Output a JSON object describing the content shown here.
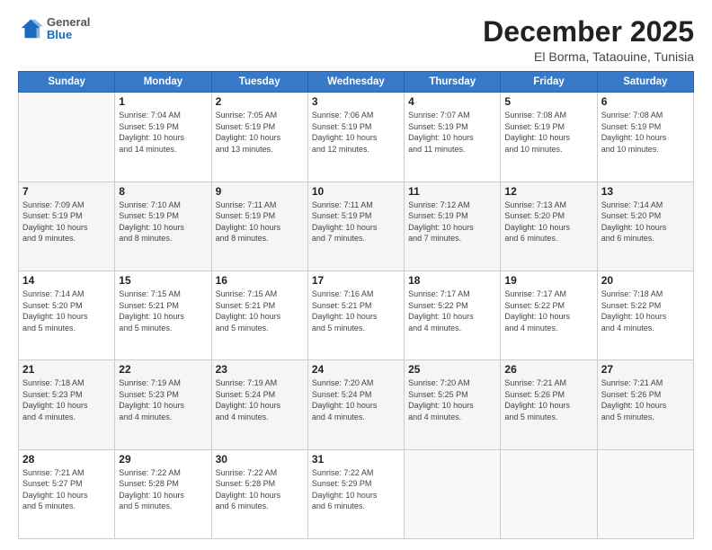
{
  "header": {
    "logo_general": "General",
    "logo_blue": "Blue",
    "month_title": "December 2025",
    "location": "El Borma, Tataouine, Tunisia"
  },
  "days_of_week": [
    "Sunday",
    "Monday",
    "Tuesday",
    "Wednesday",
    "Thursday",
    "Friday",
    "Saturday"
  ],
  "weeks": [
    [
      {
        "day": "",
        "info": ""
      },
      {
        "day": "1",
        "info": "Sunrise: 7:04 AM\nSunset: 5:19 PM\nDaylight: 10 hours\nand 14 minutes."
      },
      {
        "day": "2",
        "info": "Sunrise: 7:05 AM\nSunset: 5:19 PM\nDaylight: 10 hours\nand 13 minutes."
      },
      {
        "day": "3",
        "info": "Sunrise: 7:06 AM\nSunset: 5:19 PM\nDaylight: 10 hours\nand 12 minutes."
      },
      {
        "day": "4",
        "info": "Sunrise: 7:07 AM\nSunset: 5:19 PM\nDaylight: 10 hours\nand 11 minutes."
      },
      {
        "day": "5",
        "info": "Sunrise: 7:08 AM\nSunset: 5:19 PM\nDaylight: 10 hours\nand 10 minutes."
      },
      {
        "day": "6",
        "info": "Sunrise: 7:08 AM\nSunset: 5:19 PM\nDaylight: 10 hours\nand 10 minutes."
      }
    ],
    [
      {
        "day": "7",
        "info": "Sunrise: 7:09 AM\nSunset: 5:19 PM\nDaylight: 10 hours\nand 9 minutes."
      },
      {
        "day": "8",
        "info": "Sunrise: 7:10 AM\nSunset: 5:19 PM\nDaylight: 10 hours\nand 8 minutes."
      },
      {
        "day": "9",
        "info": "Sunrise: 7:11 AM\nSunset: 5:19 PM\nDaylight: 10 hours\nand 8 minutes."
      },
      {
        "day": "10",
        "info": "Sunrise: 7:11 AM\nSunset: 5:19 PM\nDaylight: 10 hours\nand 7 minutes."
      },
      {
        "day": "11",
        "info": "Sunrise: 7:12 AM\nSunset: 5:19 PM\nDaylight: 10 hours\nand 7 minutes."
      },
      {
        "day": "12",
        "info": "Sunrise: 7:13 AM\nSunset: 5:20 PM\nDaylight: 10 hours\nand 6 minutes."
      },
      {
        "day": "13",
        "info": "Sunrise: 7:14 AM\nSunset: 5:20 PM\nDaylight: 10 hours\nand 6 minutes."
      }
    ],
    [
      {
        "day": "14",
        "info": "Sunrise: 7:14 AM\nSunset: 5:20 PM\nDaylight: 10 hours\nand 5 minutes."
      },
      {
        "day": "15",
        "info": "Sunrise: 7:15 AM\nSunset: 5:21 PM\nDaylight: 10 hours\nand 5 minutes."
      },
      {
        "day": "16",
        "info": "Sunrise: 7:15 AM\nSunset: 5:21 PM\nDaylight: 10 hours\nand 5 minutes."
      },
      {
        "day": "17",
        "info": "Sunrise: 7:16 AM\nSunset: 5:21 PM\nDaylight: 10 hours\nand 5 minutes."
      },
      {
        "day": "18",
        "info": "Sunrise: 7:17 AM\nSunset: 5:22 PM\nDaylight: 10 hours\nand 4 minutes."
      },
      {
        "day": "19",
        "info": "Sunrise: 7:17 AM\nSunset: 5:22 PM\nDaylight: 10 hours\nand 4 minutes."
      },
      {
        "day": "20",
        "info": "Sunrise: 7:18 AM\nSunset: 5:22 PM\nDaylight: 10 hours\nand 4 minutes."
      }
    ],
    [
      {
        "day": "21",
        "info": "Sunrise: 7:18 AM\nSunset: 5:23 PM\nDaylight: 10 hours\nand 4 minutes."
      },
      {
        "day": "22",
        "info": "Sunrise: 7:19 AM\nSunset: 5:23 PM\nDaylight: 10 hours\nand 4 minutes."
      },
      {
        "day": "23",
        "info": "Sunrise: 7:19 AM\nSunset: 5:24 PM\nDaylight: 10 hours\nand 4 minutes."
      },
      {
        "day": "24",
        "info": "Sunrise: 7:20 AM\nSunset: 5:24 PM\nDaylight: 10 hours\nand 4 minutes."
      },
      {
        "day": "25",
        "info": "Sunrise: 7:20 AM\nSunset: 5:25 PM\nDaylight: 10 hours\nand 4 minutes."
      },
      {
        "day": "26",
        "info": "Sunrise: 7:21 AM\nSunset: 5:26 PM\nDaylight: 10 hours\nand 5 minutes."
      },
      {
        "day": "27",
        "info": "Sunrise: 7:21 AM\nSunset: 5:26 PM\nDaylight: 10 hours\nand 5 minutes."
      }
    ],
    [
      {
        "day": "28",
        "info": "Sunrise: 7:21 AM\nSunset: 5:27 PM\nDaylight: 10 hours\nand 5 minutes."
      },
      {
        "day": "29",
        "info": "Sunrise: 7:22 AM\nSunset: 5:28 PM\nDaylight: 10 hours\nand 5 minutes."
      },
      {
        "day": "30",
        "info": "Sunrise: 7:22 AM\nSunset: 5:28 PM\nDaylight: 10 hours\nand 6 minutes."
      },
      {
        "day": "31",
        "info": "Sunrise: 7:22 AM\nSunset: 5:29 PM\nDaylight: 10 hours\nand 6 minutes."
      },
      {
        "day": "",
        "info": ""
      },
      {
        "day": "",
        "info": ""
      },
      {
        "day": "",
        "info": ""
      }
    ]
  ]
}
